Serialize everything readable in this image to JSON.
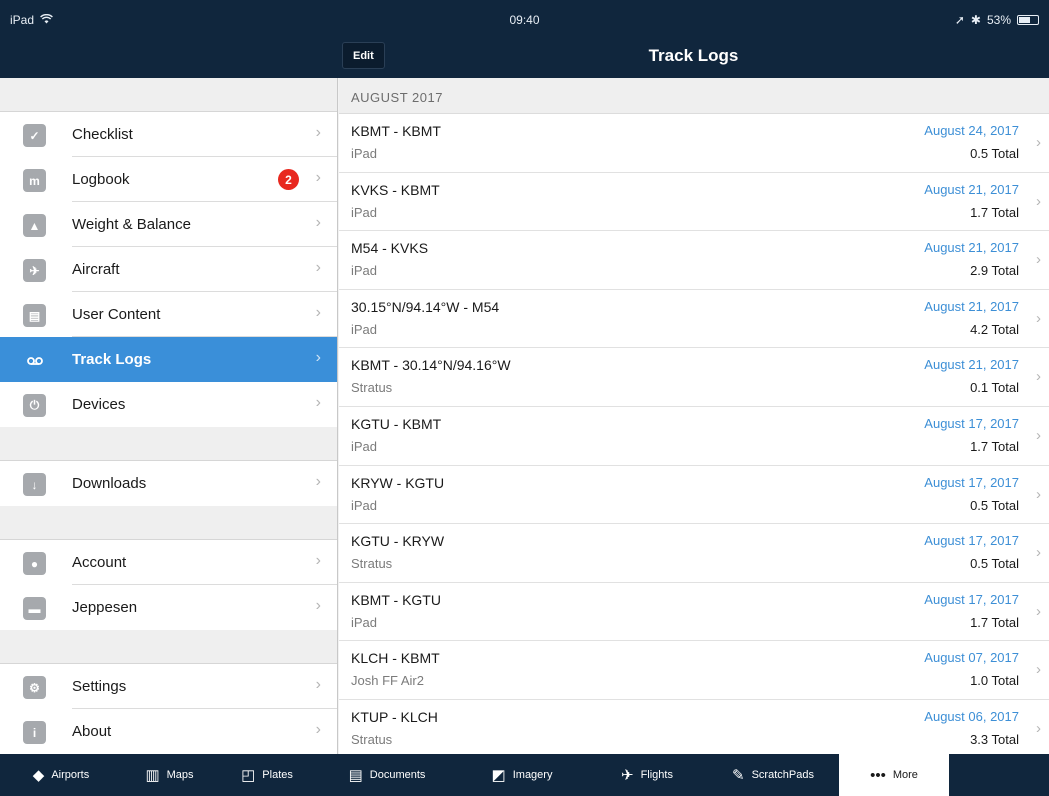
{
  "status": {
    "device": "iPad",
    "time": "09:40",
    "battery": "53%"
  },
  "nav": {
    "edit_label": "Edit",
    "title": "Track Logs"
  },
  "sidebar": {
    "groups": [
      [
        {
          "label": "Checklist",
          "icon": "check-icon"
        },
        {
          "label": "Logbook",
          "icon": "logbook-icon",
          "badge": "2"
        },
        {
          "label": "Weight & Balance",
          "icon": "weight-icon"
        },
        {
          "label": "Aircraft",
          "icon": "airplane-icon"
        },
        {
          "label": "User Content",
          "icon": "user-content-icon"
        },
        {
          "label": "Track Logs",
          "icon": "track-logs-icon",
          "selected": true
        },
        {
          "label": "Devices",
          "icon": "devices-icon"
        }
      ],
      [
        {
          "label": "Downloads",
          "icon": "download-icon"
        }
      ],
      [
        {
          "label": "Account",
          "icon": "account-icon"
        },
        {
          "label": "Jeppesen",
          "icon": "jeppesen-icon"
        }
      ],
      [
        {
          "label": "Settings",
          "icon": "gear-icon"
        },
        {
          "label": "About",
          "icon": "info-icon"
        }
      ]
    ]
  },
  "main": {
    "section_header": "AUGUST 2017",
    "logs": [
      {
        "route": "KBMT - KBMT",
        "device": "iPad",
        "date": "August 24, 2017",
        "total": "0.5 Total"
      },
      {
        "route": "KVKS - KBMT",
        "device": "iPad",
        "date": "August 21, 2017",
        "total": "1.7 Total"
      },
      {
        "route": "M54 - KVKS",
        "device": "iPad",
        "date": "August 21, 2017",
        "total": "2.9 Total"
      },
      {
        "route": "30.15°N/94.14°W - M54",
        "device": "iPad",
        "date": "August 21, 2017",
        "total": "4.2 Total"
      },
      {
        "route": "KBMT - 30.14°N/94.16°W",
        "device": "Stratus",
        "date": "August 21, 2017",
        "total": "0.1 Total"
      },
      {
        "route": "KGTU - KBMT",
        "device": "iPad",
        "date": "August 17, 2017",
        "total": "1.7 Total"
      },
      {
        "route": "KRYW - KGTU",
        "device": "iPad",
        "date": "August 17, 2017",
        "total": "0.5 Total"
      },
      {
        "route": "KGTU - KRYW",
        "device": "Stratus",
        "date": "August 17, 2017",
        "total": "0.5 Total"
      },
      {
        "route": "KBMT - KGTU",
        "device": "iPad",
        "date": "August 17, 2017",
        "total": "1.7 Total"
      },
      {
        "route": "KLCH - KBMT",
        "device": "Josh FF Air2",
        "date": "August 07, 2017",
        "total": "1.0 Total"
      },
      {
        "route": "KTUP - KLCH",
        "device": "Stratus",
        "date": "August 06, 2017",
        "total": "3.3 Total"
      }
    ]
  },
  "tabbar": {
    "tabs": [
      {
        "label": "Airports",
        "icon": "airports-icon"
      },
      {
        "label": "Maps",
        "icon": "maps-icon"
      },
      {
        "label": "Plates",
        "icon": "plates-icon"
      },
      {
        "label": "Documents",
        "icon": "documents-icon"
      },
      {
        "label": "Imagery",
        "icon": "imagery-icon"
      },
      {
        "label": "Flights",
        "icon": "flights-icon"
      },
      {
        "label": "ScratchPads",
        "icon": "scratchpads-icon"
      },
      {
        "label": "More",
        "icon": "more-icon",
        "active": true
      }
    ]
  },
  "colors": {
    "bar": "#10263d",
    "accent": "#3a8fd9",
    "date": "#3d8fd6",
    "badge": "#e8281f"
  }
}
